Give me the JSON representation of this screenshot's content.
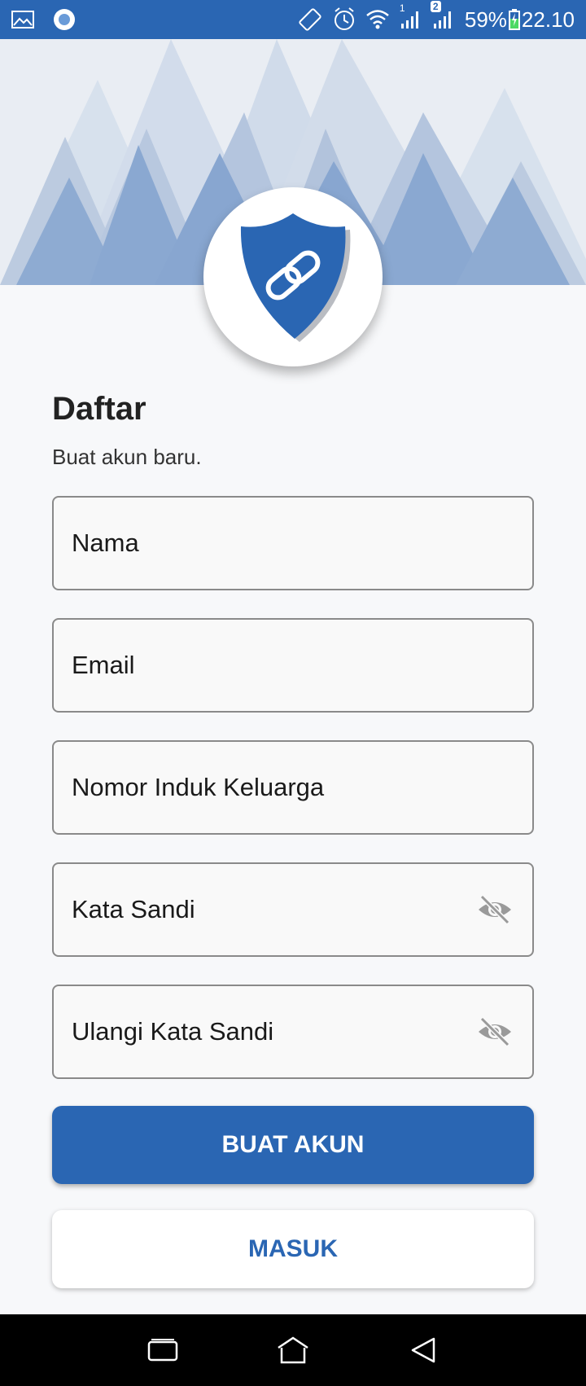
{
  "status_bar": {
    "battery": "59%",
    "time": "22.10",
    "sim1_label": "1",
    "sim2_badge": "2",
    "icons": [
      "gallery-icon",
      "record-icon",
      "auto-rotate-icon",
      "alarm-icon",
      "wifi-icon",
      "signal-icon",
      "battery-charging-icon"
    ]
  },
  "header": {
    "title": "Daftar",
    "subtitle": "Buat akun baru."
  },
  "form": {
    "name_placeholder": "Nama",
    "email_placeholder": "Email",
    "nik_placeholder": "Nomor Induk Keluarga",
    "password_placeholder": "Kata Sandi",
    "confirm_password_placeholder": "Ulangi Kata Sandi"
  },
  "buttons": {
    "create_account": "BUAT AKUN",
    "login": "MASUK"
  },
  "colors": {
    "primary": "#2a66b3",
    "background": "#f7f8fa",
    "field_border": "#8a8a8a"
  }
}
